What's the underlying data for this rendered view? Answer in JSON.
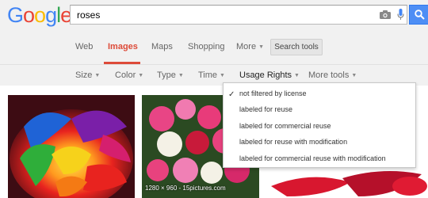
{
  "search": {
    "query": "roses"
  },
  "nav": {
    "tabs": [
      {
        "label": "Web",
        "active": false
      },
      {
        "label": "Images",
        "active": true
      },
      {
        "label": "Maps",
        "active": false
      },
      {
        "label": "Shopping",
        "active": false
      },
      {
        "label": "More",
        "active": false
      }
    ],
    "tools_label": "Search tools"
  },
  "filters": [
    {
      "label": "Size"
    },
    {
      "label": "Color"
    },
    {
      "label": "Type"
    },
    {
      "label": "Time"
    },
    {
      "label": "Usage Rights"
    },
    {
      "label": "More tools"
    }
  ],
  "usage_rights_menu": {
    "selected_index": 0,
    "items": [
      "not filtered by license",
      "labeled for reuse",
      "labeled for commercial reuse",
      "labeled for reuse with modification",
      "labeled for commercial reuse with modification"
    ]
  },
  "results": {
    "caption": "1280 × 960 - 15pictures.com"
  },
  "colors": {
    "accent": "#dd4b39",
    "search_button": "#4d8ef5"
  }
}
